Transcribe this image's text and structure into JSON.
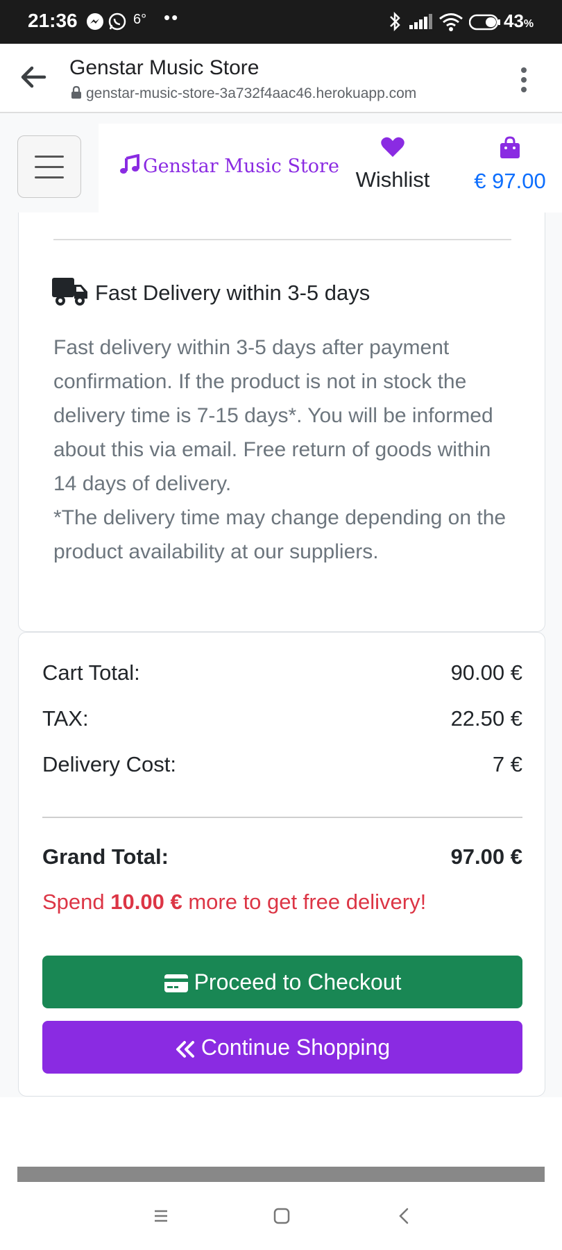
{
  "status_bar": {
    "time": "21:36",
    "temperature": "6°",
    "more_dots": "••",
    "battery_percent": "43",
    "battery_unit": "%"
  },
  "browser": {
    "page_title": "Genstar Music Store",
    "url": "genstar-music-store-3a732f4aac46.herokuapp.com"
  },
  "navbar": {
    "brand": "Genstar Music Store",
    "wishlist_label": "Wishlist",
    "cart_amount": "€ 97.00"
  },
  "delivery": {
    "title": "Fast Delivery within 3-5 days",
    "text_line_1": "Fast delivery within 3-5 days after payment confirmation. If the product is not in stock the delivery time is 7-15 days*. You will be informed about this via email. Free return of goods within 14 days of delivery.",
    "text_line_2": "*The delivery time may change depending on the product availability at our suppliers."
  },
  "totals": {
    "cart_total_label": "Cart Total:",
    "cart_total_value": "90.00 €",
    "tax_label": "TAX:",
    "tax_value": "22.50 €",
    "delivery_label": "Delivery Cost:",
    "delivery_value": "7 €",
    "grand_total_label": "Grand Total:",
    "grand_total_value": "97.00 €",
    "spend_prefix": "Spend",
    "spend_amount": "10.00 €",
    "spend_suffix": "more to get free delivery!"
  },
  "buttons": {
    "checkout": "Proceed to Checkout",
    "continue": "Continue Shopping"
  },
  "colors": {
    "brand": "#8a2be2",
    "checkout": "#198754",
    "continue": "#8a2be2",
    "price_link": "#0d6efd",
    "warning_text": "#dc3545"
  },
  "icons": {
    "status": [
      "messenger-icon",
      "whatsapp-icon",
      "bluetooth-icon",
      "signal-icon",
      "wifi-icon",
      "battery-icon"
    ],
    "navbar": [
      "hamburger-icon",
      "music-note-icon",
      "heart-icon",
      "shopping-bag-icon"
    ],
    "delivery": "truck-icon",
    "buttons": [
      "credit-card-icon",
      "double-chevron-left-icon"
    ],
    "system_nav": [
      "recents-icon",
      "home-icon",
      "back-icon"
    ]
  }
}
